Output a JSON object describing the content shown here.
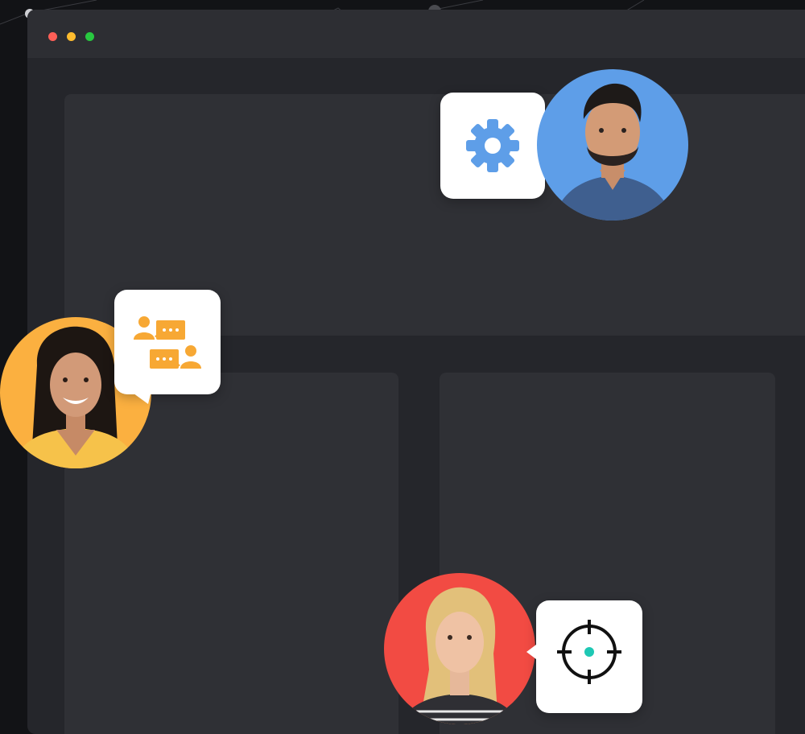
{
  "window": {
    "controls": [
      "close",
      "minimize",
      "maximize"
    ]
  },
  "panels": [
    "top-panel",
    "bottom-left-panel",
    "bottom-right-panel"
  ],
  "personas": [
    {
      "avatar": "man-with-beard",
      "bg_color": "#5e9ee8",
      "icon": "gear-icon",
      "icon_color": "#5e9ee8"
    },
    {
      "avatar": "smiling-woman",
      "bg_color": "#fbb040",
      "icon": "chat-users-icon",
      "icon_color": "#f7a834"
    },
    {
      "avatar": "blonde-woman",
      "bg_color": "#f24b43",
      "icon": "target-icon",
      "icon_color": "#1ec8b4"
    }
  ],
  "colors": {
    "background": "#121316",
    "window": "#25262b",
    "titlebar": "#2d2e33",
    "panel": "#2f3035"
  }
}
